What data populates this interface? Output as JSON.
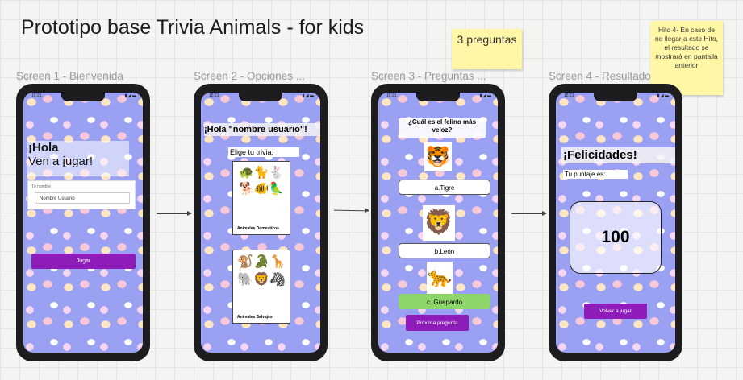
{
  "board_title": "Prototipo base Trivia Animals - for kids",
  "sticky_questions": "3 preguntas",
  "sticky_note": "Hito 4- En caso de no llegar a este Hito, el resultado se mostrará en pantalla anterior",
  "frames": {
    "s1": "Screen 1 - Bienvenida",
    "s2": "Screen 2 - Opciones ...",
    "s3": "Screen 3 - Preguntas ...",
    "s4": "Screen 4 - Resultado"
  },
  "status_time": "15:21",
  "status_icons": "▮ ◢ ▬",
  "screen1": {
    "greeting": "¡Hola",
    "subtitle": "Ven a jugar!",
    "field_label": "Tu nombre",
    "field_value": "Nombre Usuario",
    "play_button": "Jugar"
  },
  "screen2": {
    "title": "¡Hola \"nombre usuario\"!",
    "prompt": "Elige tu trivia:",
    "cards": [
      {
        "label": "Animales Domesticos",
        "icons": [
          "🐢",
          "🐈",
          "🐇",
          "🐕",
          "🐠",
          "🦜"
        ]
      },
      {
        "label": "Animales Salvajes",
        "icons": [
          "🐒",
          "🐊",
          "🦒",
          "🐘",
          "🦁",
          "🦓"
        ]
      }
    ]
  },
  "screen3": {
    "question": "¿Cuál es el felino más veloz?",
    "answers": [
      "a.Tigre",
      "b.León",
      "c. Guepardo"
    ],
    "answer_icons": [
      "🐯",
      "🦁",
      "🐆"
    ],
    "next_button": "Próxima pregunta"
  },
  "screen4": {
    "title": "¡Felicidades!",
    "score_label": "Tu puntaje es:",
    "score": "100",
    "replay_button": "Volver a jugar"
  },
  "colors": {
    "screen_bg": "#9aa0f2",
    "button": "#8e1cb8",
    "correct": "#8ed66a",
    "sticky": "#fff7a6"
  }
}
